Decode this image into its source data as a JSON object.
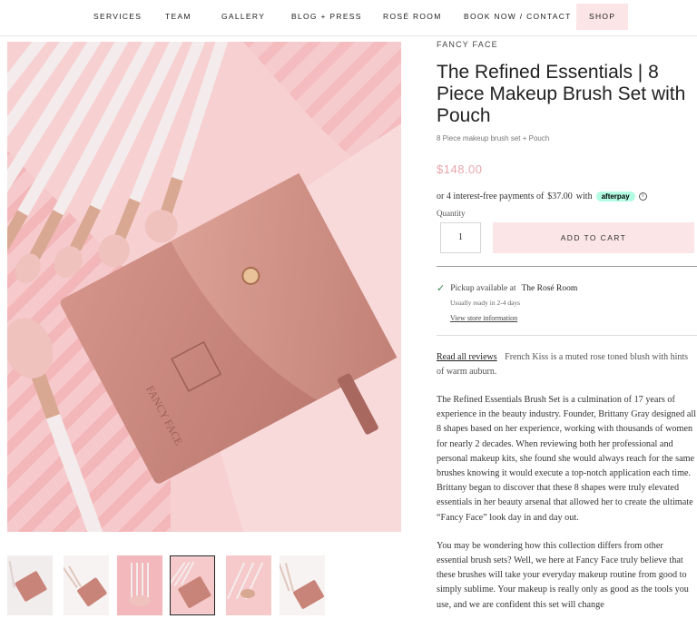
{
  "nav": {
    "items": [
      "SERVICES",
      "TEAM",
      "GALLERY",
      "BLOG + PRESS",
      "ROSÉ ROOM",
      "BOOK NOW / CONTACT",
      "SHOP"
    ]
  },
  "product": {
    "brand": "FANCY FACE",
    "title": "The Refined Essentials | 8 Piece Makeup Brush Set with Pouch",
    "subtitle": "8 Piece makeup brush set + Pouch",
    "price": "$148.00",
    "afterpay": {
      "prefix": "or 4 interest-free payments of",
      "amount": "$37.00",
      "suffix": "with",
      "badge": "afterpay",
      "info_icon": "i"
    },
    "quantity_label": "Quantity",
    "quantity_value": "1",
    "add_to_cart": "ADD TO CART",
    "pickup": {
      "check_icon": "✓",
      "text": "Pickup available at",
      "location": "The Rosé Room",
      "ready": "Usually ready in 2-4 days",
      "link": "View store information"
    },
    "reviews_link": "Read all reviews",
    "reviews_text": "French Kiss is a muted rose toned blush with hints of warm auburn.",
    "description": [
      "The Refined Essentials Brush Set is a culmination of 17 years of experience in the beauty industry. Founder, Brittany Gray designed all 8 shapes based on her experience, working with thousands of women for nearly 2 decades. When reviewing both her professional and personal makeup kits, she found she would always reach for the same brushes knowing it would execute a top-notch application each time. Brittany began to discover that these 8 shapes were truly elevated essentials in her beauty arsenal that allowed her to create the ultimate “Fancy Face” look day in and day out.",
      "You may be wondering how this collection differs from other essential brush sets? Well, we here at Fancy Face truly believe that these brushes will take your everyday makeup routine from good to simply sublime. Your makeup is really only as good as the tools you use, and we are confident this set will change"
    ]
  },
  "gallery": {
    "thumb_count": 6,
    "active_index": 3,
    "colors": {
      "pink_bg": "#f6c9cb",
      "pouch": "#c98479",
      "handle": "#f4ecec",
      "ferrule": "#d9a892",
      "bristle": "#efc2bd"
    }
  },
  "colors": {
    "accent_pink": "#fbe5e6",
    "price": "#e7a6ab",
    "afterpay_mint": "#b2fce4"
  }
}
